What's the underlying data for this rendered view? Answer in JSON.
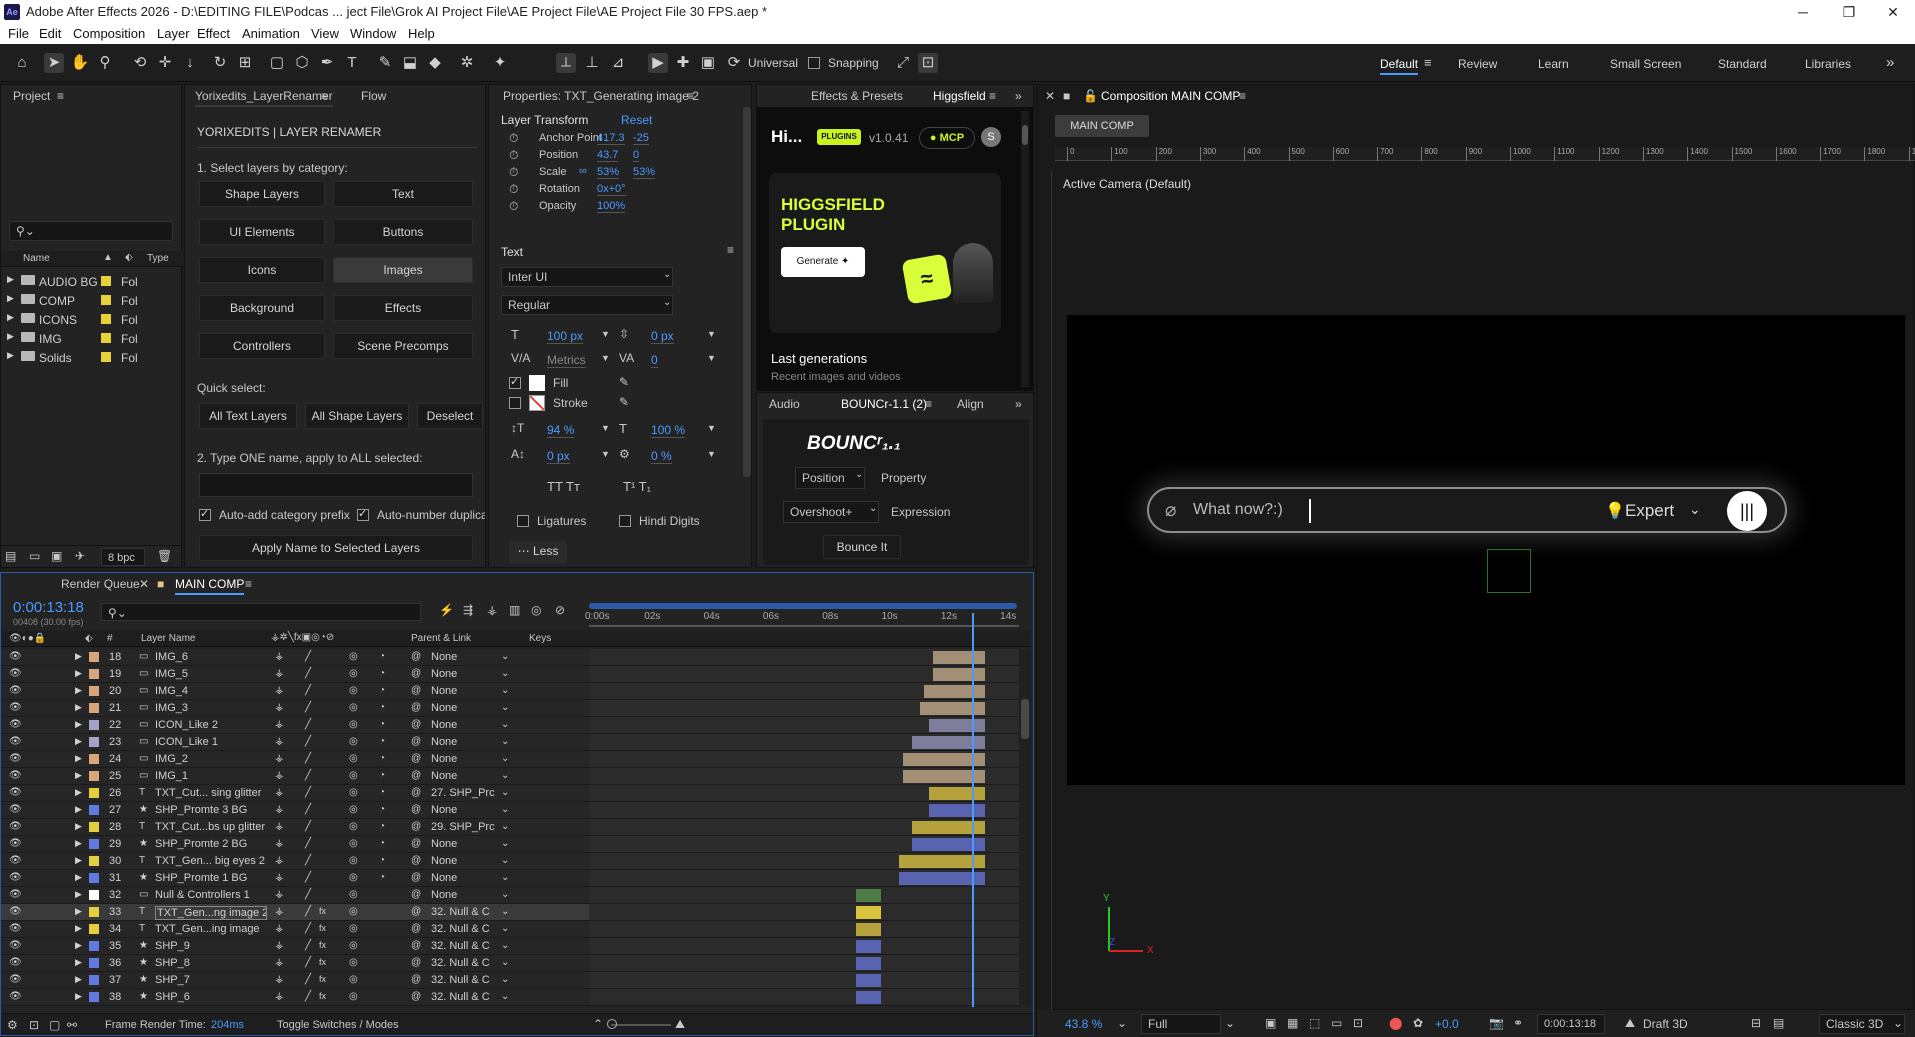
{
  "window": {
    "title": "Adobe After Effects 2026 - D:\\EDITING FILE\\Podcas ... ject File\\Grok AI Project File\\AE Project File\\AE Project File 30 FPS.aep *",
    "app_badge": "Ae",
    "minimize": "─",
    "maximize": "❐",
    "close": "✕"
  },
  "menu": [
    "File",
    "Edit",
    "Composition",
    "Layer",
    "Effect",
    "Animation",
    "View",
    "Window",
    "Help"
  ],
  "toolbar": {
    "universal": "Universal",
    "snapping": "Snapping"
  },
  "workspaces": [
    "Default",
    "Review",
    "Learn",
    "Small Screen",
    "Standard",
    "Libraries"
  ],
  "workspace_more": "»",
  "project": {
    "tab": "Project",
    "search_placeholder": "⚲⌄",
    "col_name": "Name",
    "col_type": "Type",
    "items": [
      {
        "name": "AUDIO BG",
        "type": "Fol"
      },
      {
        "name": "COMP",
        "type": "Fol"
      },
      {
        "name": "ICONS",
        "type": "Fol"
      },
      {
        "name": "IMG",
        "type": "Fol"
      },
      {
        "name": "Solids",
        "type": "Fol"
      }
    ],
    "bpc": "8 bpc"
  },
  "renamer": {
    "tab": "Yorixedits_LayerRenamer",
    "tab2": "Flow",
    "title": "YORIXEDITS  |  LAYER RENAMER",
    "step1": "1. Select layers by category:",
    "buttons": [
      "Shape Layers",
      "Text",
      "UI Elements",
      "Buttons",
      "Icons",
      "Images",
      "Background",
      "Effects",
      "Controllers",
      "Scene Precomps"
    ],
    "quick": "Quick select:",
    "quick_buttons": [
      "All Text Layers",
      "All Shape Layers",
      "Deselect"
    ],
    "step2": "2. Type ONE name, apply to ALL selected:",
    "auto_prefix": "Auto-add category prefix",
    "auto_number": "Auto-number duplicat",
    "apply": "Apply Name to Selected Layers"
  },
  "properties": {
    "tab": "Properties: TXT_Generating image 2",
    "layer_transform": "Layer Transform",
    "reset": "Reset",
    "rows": [
      {
        "label": "Anchor Point",
        "v1": "417.3",
        "v2": "-25"
      },
      {
        "label": "Position",
        "v1": "43.7",
        "v2": "0"
      },
      {
        "label": "Scale",
        "v1": "53%",
        "v2": "53%"
      },
      {
        "label": "Rotation",
        "v1": "0x+0°",
        "v2": ""
      },
      {
        "label": "Opacity",
        "v1": "100%",
        "v2": ""
      }
    ],
    "text_section": "Text",
    "font": "Inter UI",
    "style": "Regular",
    "size": "100 px",
    "leading": "0 px",
    "kerning": "Metrics",
    "tracking": "0",
    "fill": "Fill",
    "stroke": "Stroke",
    "vscale": "94 %",
    "hscale": "100 %",
    "baseline": "0 px",
    "tsume": "0 %",
    "caps": "TT  Tт",
    "supsub": "T¹  T₁",
    "ligatures": "Ligatures",
    "hindi": "Hindi Digits",
    "less": "Less"
  },
  "effects": {
    "tab": "Effects & Presets",
    "tab2": "Higgsfield",
    "hi": "Hi...",
    "plugins": "PLUGINS",
    "version": "v1.0.41",
    "mcp": "MCP",
    "avatar": "S",
    "promo_title": "HIGGSFIELD PLUGIN",
    "generate": "Generate",
    "last_gen": "Last generations",
    "recent": "Recent images and videos"
  },
  "bouncr": {
    "tab1": "Audio",
    "tab2": "BOUNCr-1.1 (2)",
    "tab3": "Align",
    "logo": "BOUNCʳ₁.₁",
    "sel1": "Position",
    "prop": "Property",
    "sel2": "Overshoot+",
    "expr": "Expression",
    "bounce": "Bounce It"
  },
  "comp": {
    "tab": "Composition MAIN COMP",
    "breadcrumb": "MAIN COMP",
    "camera": "Active Camera (Default)",
    "ruler": [
      "0",
      "100",
      "200",
      "300",
      "400",
      "500",
      "600",
      "700",
      "800",
      "900",
      "1000",
      "1100",
      "1200",
      "1300",
      "1400",
      "1500",
      "1600",
      "1700",
      "1800",
      "190"
    ],
    "prompt": "What now?:)",
    "expert": "Expert",
    "zoom": "43.8 %",
    "quality": "Full",
    "exposure": "+0.0",
    "time": "0:00:13:18",
    "draft": "Draft 3D",
    "renderer": "Classic 3D"
  },
  "timeline": {
    "tab1": "Render Queue",
    "tab2": "MAIN COMP",
    "timecode": "0:00:13:18",
    "frames": "00408 (30.00 fps)",
    "col_layer": "Layer Name",
    "col_parent": "Parent & Link",
    "col_keys": "Keys",
    "ruler": [
      "0:00s",
      "02s",
      "04s",
      "06s",
      "08s",
      "10s",
      "12s",
      "14s"
    ],
    "footer_frt": "Frame Render Time:",
    "footer_ms": "204ms",
    "footer_toggle": "Toggle Switches / Modes",
    "layers": [
      {
        "n": "18",
        "name": "IMG_6",
        "t": "img",
        "parent": "None",
        "c": "#d9a57a",
        "s": 0.8,
        "e": 0.92,
        "bc": "#a38f76"
      },
      {
        "n": "19",
        "name": "IMG_5",
        "t": "img",
        "parent": "None",
        "c": "#d9a57a",
        "s": 0.8,
        "e": 0.92,
        "bc": "#a38f76"
      },
      {
        "n": "20",
        "name": "IMG_4",
        "t": "img",
        "parent": "None",
        "c": "#d9a57a",
        "s": 0.78,
        "e": 0.92,
        "bc": "#a38f76"
      },
      {
        "n": "21",
        "name": "IMG_3",
        "t": "img",
        "parent": "None",
        "c": "#d9a57a",
        "s": 0.77,
        "e": 0.92,
        "bc": "#a38f76"
      },
      {
        "n": "22",
        "name": "ICON_Like 2",
        "t": "img",
        "parent": "None",
        "c": "#a3a3c9",
        "s": 0.79,
        "e": 0.92,
        "bc": "#7e7e9c"
      },
      {
        "n": "23",
        "name": "ICON_Like 1",
        "t": "img",
        "parent": "None",
        "c": "#a3a3c9",
        "s": 0.75,
        "e": 0.92,
        "bc": "#7e7e9c"
      },
      {
        "n": "24",
        "name": "IMG_2",
        "t": "img",
        "parent": "None",
        "c": "#d9a57a",
        "s": 0.73,
        "e": 0.92,
        "bc": "#a38f76"
      },
      {
        "n": "25",
        "name": "IMG_1",
        "t": "img",
        "parent": "None",
        "c": "#d9a57a",
        "s": 0.73,
        "e": 0.92,
        "bc": "#a38f76"
      },
      {
        "n": "26",
        "name": "TXT_Cut... sing glitter",
        "t": "txt",
        "parent": "27. SHP_Prc",
        "c": "#e5cf3f",
        "s": 0.79,
        "e": 0.92,
        "bc": "#b5a23c"
      },
      {
        "n": "27",
        "name": "SHP_Promte 3 BG",
        "t": "shp",
        "parent": "None",
        "c": "#5f7ae0",
        "s": 0.79,
        "e": 0.92,
        "bc": "#5864b0"
      },
      {
        "n": "28",
        "name": "TXT_Cut...bs up glitter",
        "t": "txt",
        "parent": "29. SHP_Prc",
        "c": "#e5cf3f",
        "s": 0.75,
        "e": 0.92,
        "bc": "#b5a23c"
      },
      {
        "n": "29",
        "name": "SHP_Promte 2 BG",
        "t": "shp",
        "parent": "None",
        "c": "#5f7ae0",
        "s": 0.75,
        "e": 0.92,
        "bc": "#5864b0"
      },
      {
        "n": "30",
        "name": "TXT_Gen... big eyes 2",
        "t": "txt",
        "parent": "None",
        "c": "#e5cf3f",
        "s": 0.72,
        "e": 0.92,
        "bc": "#b5a23c"
      },
      {
        "n": "31",
        "name": "SHP_Promte 1 BG",
        "t": "shp",
        "parent": "None",
        "c": "#5f7ae0",
        "s": 0.72,
        "e": 0.92,
        "bc": "#5864b0"
      },
      {
        "n": "32",
        "name": "Null & Controllers 1",
        "t": "null",
        "parent": "None",
        "c": "#ffffff",
        "s": 0.62,
        "e": 0.68,
        "bc": "#4d7a45"
      },
      {
        "n": "33",
        "name": "TXT_Gen...ng image 2",
        "t": "txt",
        "parent": "32. Null & C",
        "c": "#e5cf3f",
        "s": 0.62,
        "e": 0.68,
        "bc": "#d8c43e",
        "sel": true
      },
      {
        "n": "34",
        "name": "TXT_Gen...ing image",
        "t": "txt",
        "parent": "32. Null & C",
        "c": "#e5cf3f",
        "s": 0.62,
        "e": 0.68,
        "bc": "#b5a23c"
      },
      {
        "n": "35",
        "name": "SHP_9",
        "t": "shp",
        "parent": "32. Null & C",
        "c": "#5f7ae0",
        "s": 0.62,
        "e": 0.68,
        "bc": "#5864b0"
      },
      {
        "n": "36",
        "name": "SHP_8",
        "t": "shp",
        "parent": "32. Null & C",
        "c": "#5f7ae0",
        "s": 0.62,
        "e": 0.68,
        "bc": "#5864b0"
      },
      {
        "n": "37",
        "name": "SHP_7",
        "t": "shp",
        "parent": "32. Null & C",
        "c": "#5f7ae0",
        "s": 0.62,
        "e": 0.68,
        "bc": "#5864b0"
      },
      {
        "n": "38",
        "name": "SHP_6",
        "t": "shp",
        "parent": "32. Null & C",
        "c": "#5f7ae0",
        "s": 0.62,
        "e": 0.68,
        "bc": "#5864b0"
      }
    ]
  }
}
